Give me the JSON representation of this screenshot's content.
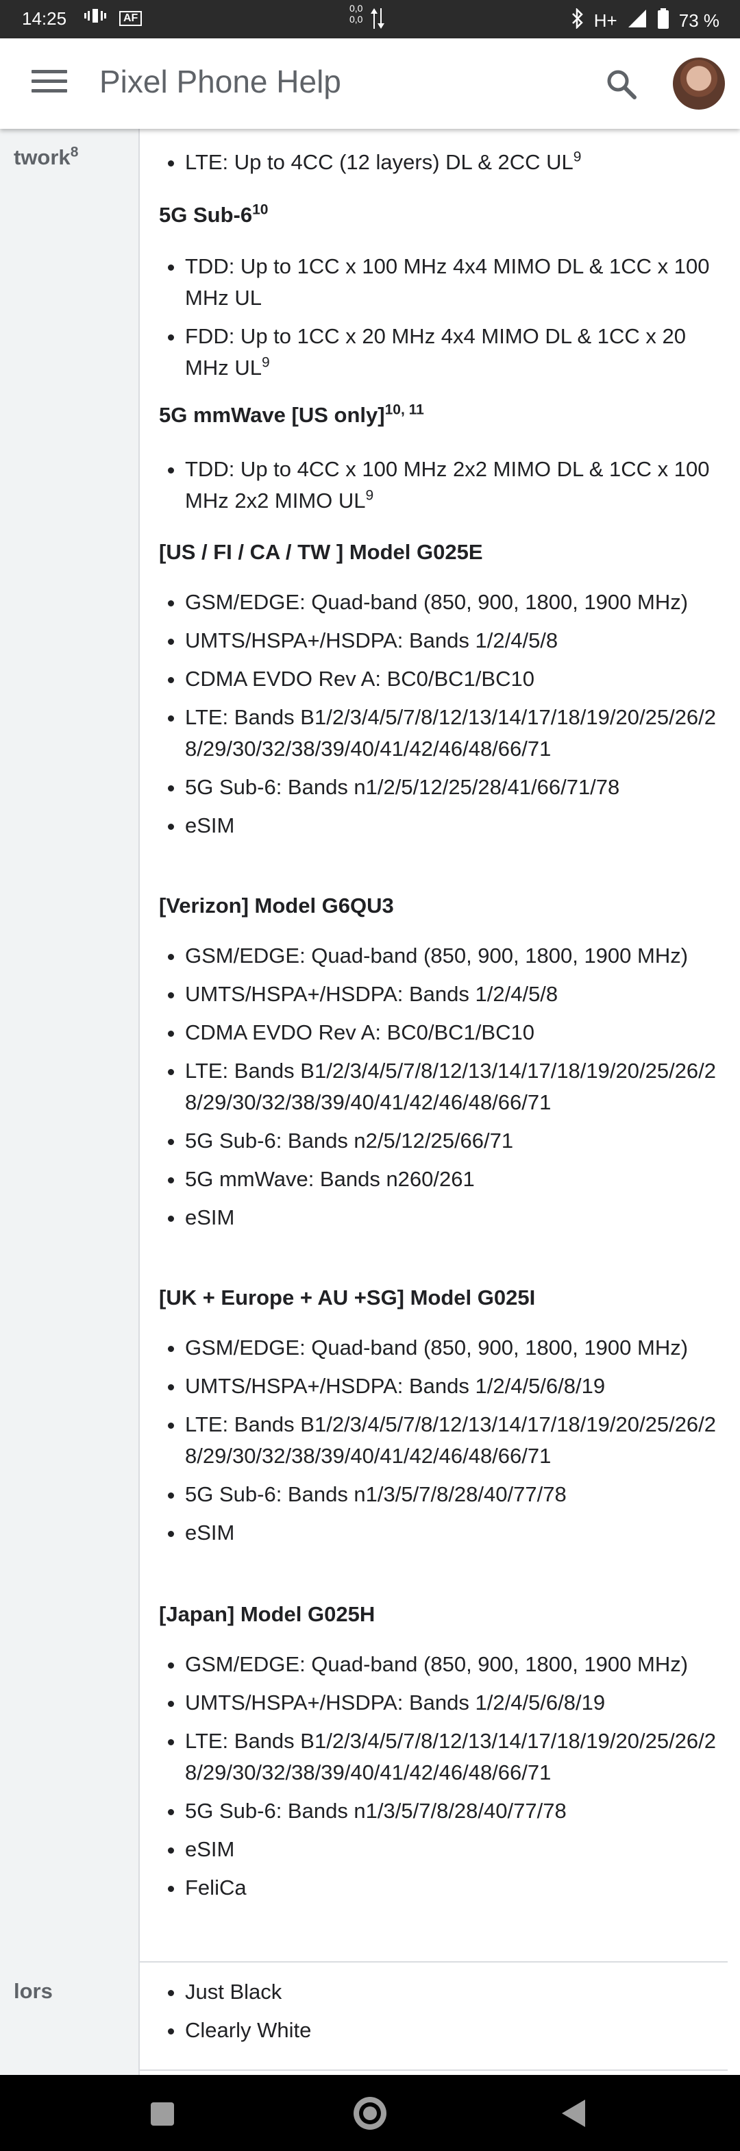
{
  "status_bar": {
    "time": "14:25",
    "carrier_badge": "AF",
    "net_up": "0,0",
    "net_down": "0,0",
    "network_type": "H+",
    "battery": "73 %"
  },
  "app_bar": {
    "title": "Pixel Phone Help"
  },
  "rows": {
    "network": {
      "label": "twork",
      "label_sup": "8"
    },
    "colors": {
      "label": "lors",
      "items": [
        "Just Black",
        "Clearly White"
      ]
    }
  },
  "content": {
    "lte_top": {
      "text": "LTE: Up to 4CC (12 layers) DL & 2CC UL",
      "sup": "9"
    },
    "sub6_heading": {
      "text": "5G Sub-6",
      "sup": "10"
    },
    "sub6_items": [
      {
        "text": "TDD: Up to 1CC x 100 MHz 4x4 MIMO DL & 1CC x 100 MHz UL",
        "sup": ""
      },
      {
        "text": "FDD: Up to 1CC x 20 MHz 4x4 MIMO DL & 1CC x 20 MHz UL",
        "sup": "9"
      }
    ],
    "mmwave_heading": {
      "text": "5G mmWave [US only]",
      "sup": "10, 11"
    },
    "mmwave_items": [
      {
        "text": "TDD: Up to 4CC x 100 MHz 2x2 MIMO DL & 1CC x 100 MHz 2x2 MIMO UL",
        "sup": "9"
      }
    ],
    "models": [
      {
        "heading": "[US / FI / CA / TW ] Model G025E",
        "items": [
          "GSM/EDGE: Quad-band (850, 900, 1800, 1900 MHz)",
          "UMTS/HSPA+/HSDPA: Bands 1/2/4/5/8",
          "CDMA EVDO Rev A: BC0/BC1/BC10",
          "LTE: Bands B1/2/3/4/5/7/8/12/13/14/17/18/19/20/25/26/28/29/30/32/38/39/40/41/42/46/48/66/71",
          "5G Sub-6: Bands n1/2/5/12/25/28/41/66/71/78",
          "eSIM"
        ]
      },
      {
        "heading": "[Verizon] Model G6QU3",
        "items": [
          "GSM/EDGE: Quad-band (850, 900, 1800, 1900 MHz)",
          "UMTS/HSPA+/HSDPA: Bands 1/2/4/5/8",
          "CDMA EVDO Rev A: BC0/BC1/BC10",
          "LTE: Bands B1/2/3/4/5/7/8/12/13/14/17/18/19/20/25/26/28/29/30/32/38/39/40/41/42/46/48/66/71",
          "5G Sub-6: Bands n2/5/12/25/66/71",
          "5G mmWave: Bands n260/261",
          "eSIM"
        ]
      },
      {
        "heading": "[UK + Europe + AU +SG] Model G025I",
        "items": [
          "GSM/EDGE: Quad-band (850, 900, 1800, 1900 MHz)",
          "UMTS/HSPA+/HSDPA: Bands 1/2/4/5/6/8/19",
          "LTE: Bands B1/2/3/4/5/7/8/12/13/14/17/18/19/20/25/26/28/29/30/32/38/39/40/41/42/46/48/66/71",
          "5G Sub-6: Bands n1/3/5/7/8/28/40/77/78",
          "eSIM"
        ]
      },
      {
        "heading": "[Japan] Model G025H",
        "items": [
          "GSM/EDGE: Quad-band (850, 900, 1800, 1900 MHz)",
          "UMTS/HSPA+/HSDPA: Bands 1/2/4/5/6/8/19",
          "LTE: Bands B1/2/3/4/5/7/8/12/13/14/17/18/19/20/25/26/28/29/30/32/38/39/40/41/42/46/48/66/71",
          "5G Sub-6: Bands n1/3/5/7/8/28/40/77/78",
          "eSIM",
          "FeliCa"
        ]
      }
    ]
  }
}
